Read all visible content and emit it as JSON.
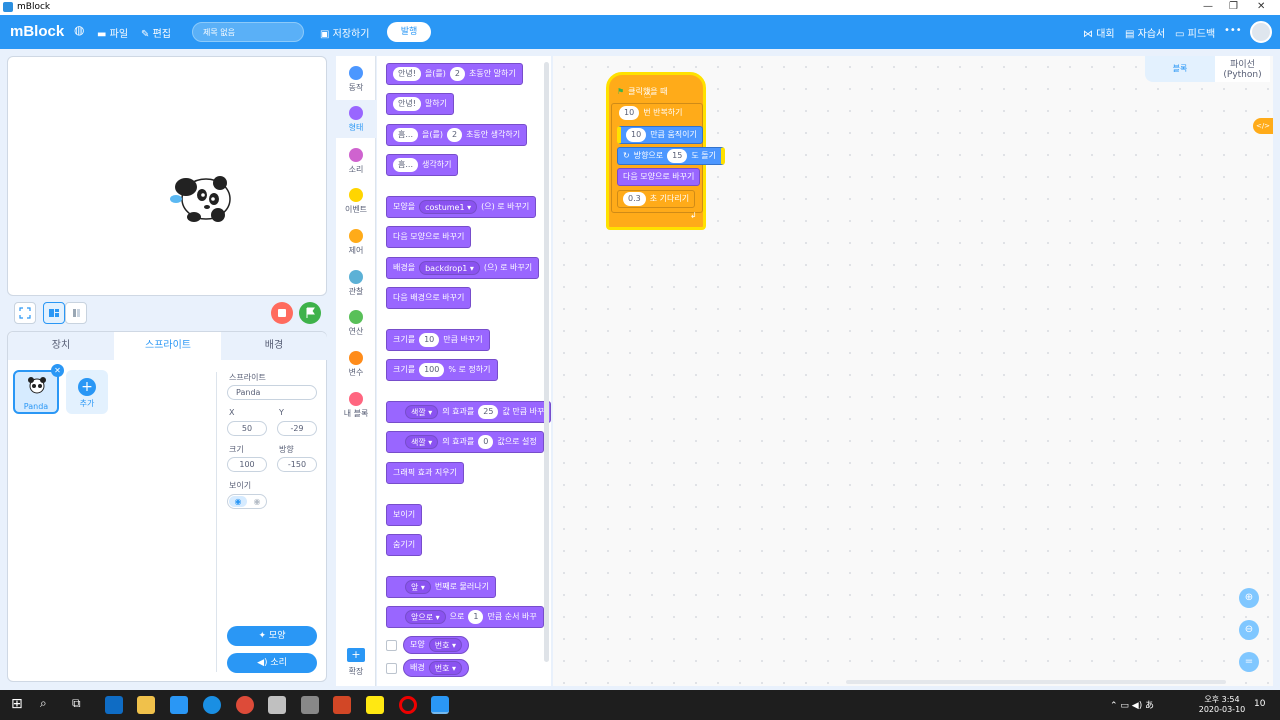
{
  "window": {
    "title": "mBlock"
  },
  "menubar": {
    "brand": "mBlock",
    "file": "파일",
    "edit": "편집",
    "project_title": "제목 없음",
    "save": "저장하기",
    "publish": "발행",
    "connect": "대회",
    "tutorials": "자습서",
    "feedback": "피드백",
    "more": "•••"
  },
  "stage_tabs": {
    "devices": "장치",
    "sprites": "스프라이트",
    "backdrops": "배경"
  },
  "sprite_list": {
    "thumb_label": "Panda",
    "add_label": "추가"
  },
  "sprite_props": {
    "section": "스프라이트",
    "name": "Panda",
    "x_label": "X",
    "x": "50",
    "y_label": "Y",
    "y": "-29",
    "size_label": "크기",
    "size": "100",
    "direction_label": "방향",
    "direction": "-150",
    "show_label": "보이기",
    "costumes": "모양",
    "sounds": "소리"
  },
  "categories": [
    {
      "label": "동작",
      "color": "#4c97ff"
    },
    {
      "label": "형태",
      "color": "#9966ff"
    },
    {
      "label": "소리",
      "color": "#cf63cf"
    },
    {
      "label": "이벤트",
      "color": "#ffd500"
    },
    {
      "label": "제어",
      "color": "#ffab19"
    },
    {
      "label": "관찰",
      "color": "#5cb1d6"
    },
    {
      "label": "연산",
      "color": "#59c059"
    },
    {
      "label": "변수",
      "color": "#ff8c1a"
    },
    {
      "label": "내 블록",
      "color": "#ff6680"
    }
  ],
  "extension": "확장",
  "palette": {
    "b1": {
      "v1": "안녕!",
      "t1": "을(를)",
      "v2": "2",
      "t2": "초동안 말하기"
    },
    "b2": {
      "v1": "안녕!",
      "t1": "말하기"
    },
    "b3": {
      "v1": "흠...",
      "t1": "을(를)",
      "v2": "2",
      "t2": "초동안 생각하기"
    },
    "b4": {
      "v1": "흠...",
      "t1": "생각하기"
    },
    "b5": {
      "t1": "모양을",
      "dd": "costume1 ▾",
      "t2": "(으) 로 바꾸기"
    },
    "b6": {
      "t1": "다음 모양으로 바꾸기"
    },
    "b7": {
      "t1": "배경을",
      "dd": "backdrop1 ▾",
      "t2": "(으) 로 바꾸기"
    },
    "b8": {
      "t1": "다음 배경으로 바꾸기"
    },
    "b9": {
      "t1": "크기를",
      "v1": "10",
      "t2": "만큼 바꾸기"
    },
    "b10": {
      "t1": "크기를",
      "v1": "100",
      "t2": "% 로 정하기"
    },
    "b11": {
      "dd": "색깔 ▾",
      "t1": "의 효과를",
      "v1": "25",
      "t2": "값 만큼 바꾸"
    },
    "b12": {
      "dd": "색깔 ▾",
      "t1": "의 효과를",
      "v1": "0",
      "t2": "값으로 설정"
    },
    "b13": {
      "t1": "그래픽 효과 지우기"
    },
    "b14": {
      "t1": "보이기"
    },
    "b15": {
      "t1": "숨기기"
    },
    "b16": {
      "dd": "앞 ▾",
      "t1": "번째로 물러나기"
    },
    "b17": {
      "dd": "앞으로 ▾",
      "t1": "으로",
      "v1": "1",
      "t2": "만큼 순서 바꾸"
    },
    "r1": {
      "t1": "모양",
      "dd": "번호 ▾"
    },
    "r2": {
      "t1": "배경",
      "dd": "번호 ▾"
    }
  },
  "workspace": {
    "tab_blocks": "블록",
    "tab_python_1": "파이선",
    "tab_python_2": "(Python)",
    "code_icon": "</>",
    "script": {
      "hat": "클릭했을 때",
      "repeat_n": "10",
      "repeat_t": "번 반복하기",
      "move_n": "10",
      "move_t": "만큼 움직이기",
      "turn_t1": "방향으로",
      "turn_n": "15",
      "turn_t2": "도 돌기",
      "next_costume": "다음 모양으로 바꾸기",
      "wait_n": "0.3",
      "wait_t": "초 기다리기"
    }
  },
  "taskbar": {
    "time": "오후 3:54",
    "date": "2020-03-10",
    "notif": "10"
  }
}
